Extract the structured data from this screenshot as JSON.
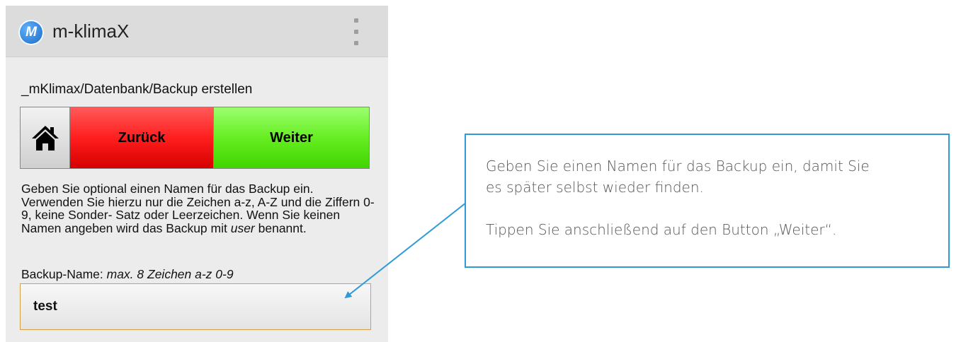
{
  "app": {
    "logo_text": "M",
    "title": "m-klimaX",
    "menu_icon": "overflow-menu-icon"
  },
  "breadcrumb": "_mKlimax/Datenbank/Backup erstellen",
  "nav": {
    "home_icon": "home-icon",
    "back_label": "Zurück",
    "next_label": "Weiter"
  },
  "instructions": {
    "before": "Geben Sie optional einen Namen für das Backup ein. Verwenden Sie hierzu nur die Zeichen a-z, A-Z und die Ziffern 0-9, keine Sonder- Satz oder Leerzeichen. Wenn Sie keinen Namen angeben wird das Backup mit ",
    "emphasis": "user",
    "after": " benannt."
  },
  "backup_field": {
    "label": "Backup-Name:",
    "hint": "max. 8 Zeichen a-z 0-9",
    "value": "test"
  },
  "callout": {
    "line1": "Geben Sie einen Namen für das Backup ein, damit Sie",
    "line2": "es später selbst wieder finden.",
    "line3": "Tippen Sie anschließend auf den Button „Weiter“."
  },
  "colors": {
    "callout_border": "#2e9ad6",
    "back": "#ff1e1e",
    "next": "#66ee22",
    "input_border": "#d4a04a"
  }
}
